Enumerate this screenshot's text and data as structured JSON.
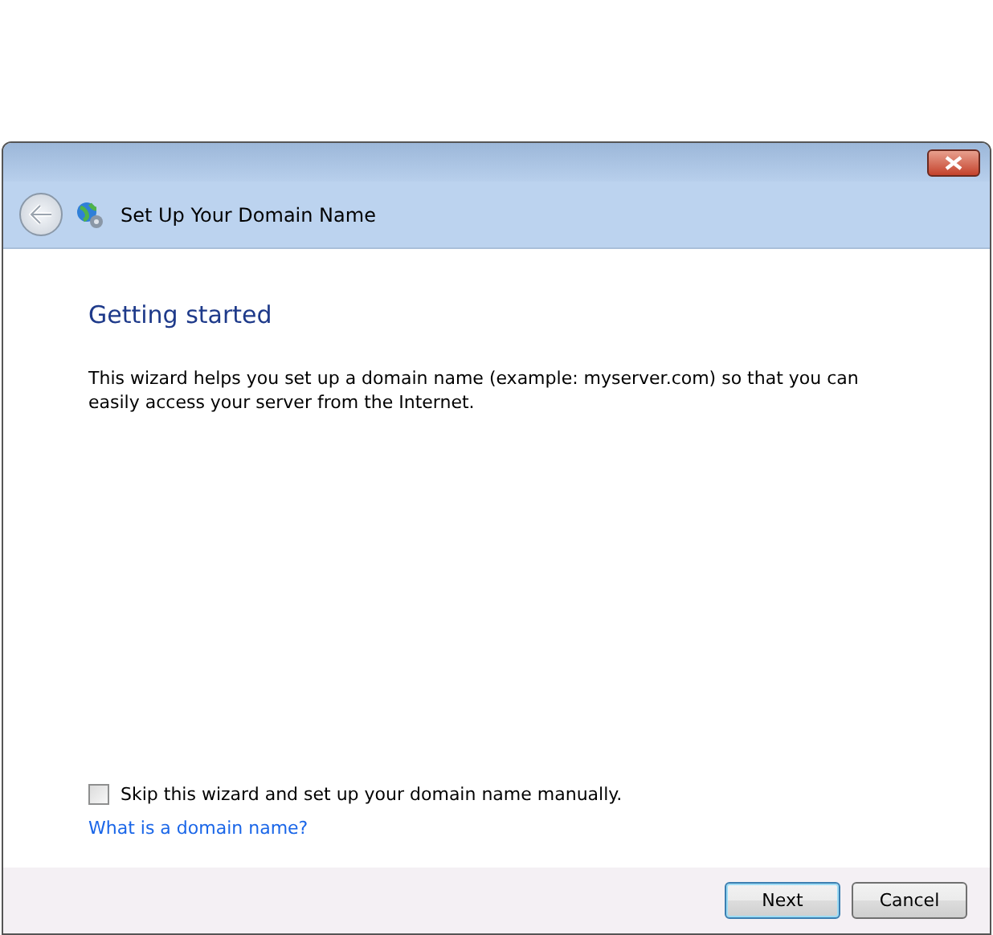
{
  "window": {
    "title": "Set Up Your Domain Name"
  },
  "page": {
    "heading": "Getting started",
    "description": "This wizard helps you set up a domain name (example: myserver.com) so that you can easily access your server from the Internet."
  },
  "skip_option": {
    "label": "Skip this wizard and set up your domain name manually.",
    "checked": false
  },
  "help_link": "What is a domain name?",
  "buttons": [
    {
      "label": "Next",
      "default": true
    },
    {
      "label": "Cancel",
      "default": false
    }
  ]
}
